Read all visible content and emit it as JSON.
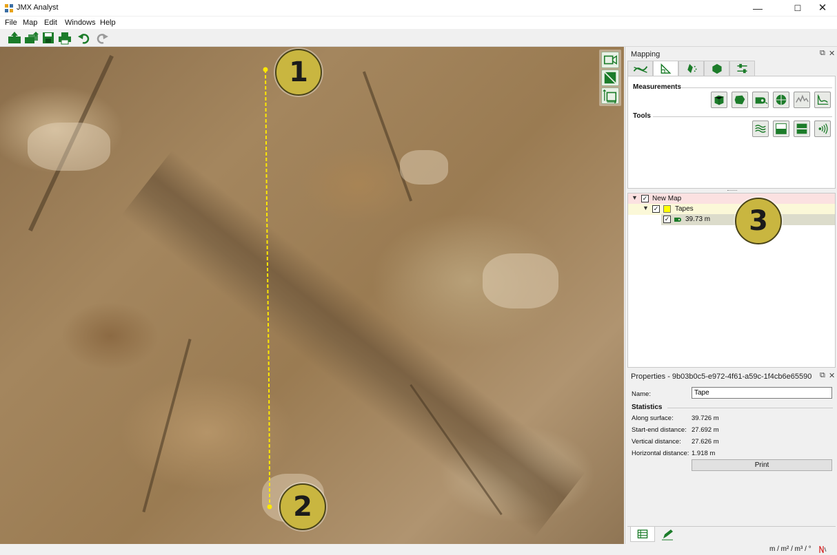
{
  "window": {
    "title": "JMX Analyst",
    "controls": [
      "—",
      "☐",
      "✕"
    ]
  },
  "menu": [
    "File",
    "Map",
    "Edit",
    "Windows",
    "Help"
  ],
  "toolbar": [
    "new-map-icon",
    "import-icon",
    "save-icon",
    "print-icon",
    "undo-icon",
    "redo-icon"
  ],
  "viewport": {
    "markers": [
      "1",
      "2"
    ],
    "view_tools": [
      "camera-icon",
      "diagonal-view-icon",
      "frame-extent-icon"
    ]
  },
  "mapping_panel": {
    "title": "Mapping",
    "tabs": [
      "structure-icon",
      "measurement-icon",
      "spray-icon",
      "block-icon",
      "settings-sliders-icon"
    ],
    "measurements_label": "Measurements",
    "tools_label": "Tools",
    "measurement_tools": [
      "volume-icon",
      "area-icon",
      "tape-icon",
      "orientation-icon",
      "roughness-icon",
      "profile-icon"
    ],
    "tools": [
      "layers-icon",
      "split-lower-icon",
      "split-upper-icon",
      "signal-icon"
    ]
  },
  "tree": {
    "map_name": "New Map",
    "group_name": "Tapes",
    "group_color": "#ffff00",
    "item_name": "39.73 m",
    "marker": "3"
  },
  "properties": {
    "title": "Properties - 9b03b0c5-e972-4f61-a59c-1f4cb6e65590",
    "name_label": "Name:",
    "name_value": "Tape",
    "statistics_label": "Statistics",
    "stats": [
      {
        "label": "Along surface:",
        "value": "39.726 m"
      },
      {
        "label": "Start-end distance:",
        "value": "27.692 m"
      },
      {
        "label": "Vertical distance:",
        "value": "27.626 m"
      },
      {
        "label": "Horizontal distance:",
        "value": "1.918 m"
      }
    ],
    "print_label": "Print"
  },
  "bottom_tabs": [
    "table-icon",
    "edit-pen-icon"
  ],
  "status": {
    "units": "m / m² / m³ / °"
  },
  "colors": {
    "marker_fill": "#c9b640",
    "tape_line": "#ffe800",
    "map_row": "#fbe1e1",
    "group_row": "#fbf8d8",
    "item_row": "#dcdccb"
  }
}
